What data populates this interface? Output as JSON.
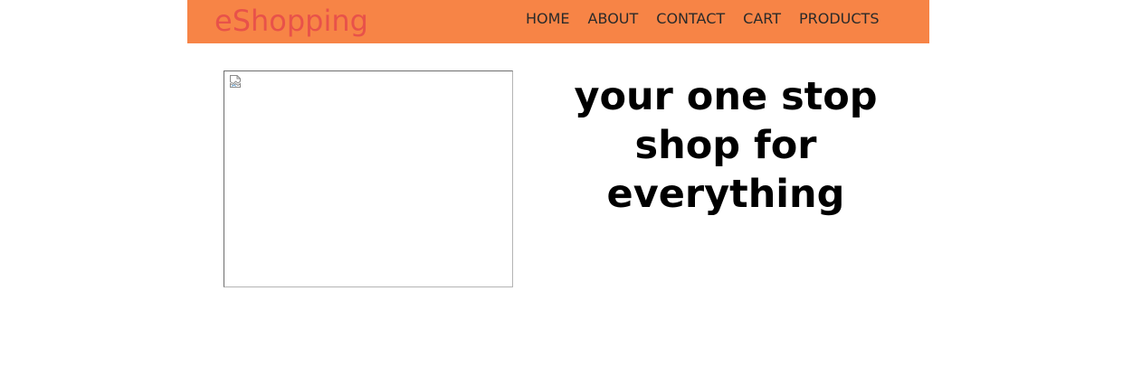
{
  "header": {
    "brand": "eShopping",
    "nav": [
      {
        "label": "HOME"
      },
      {
        "label": "ABOUT"
      },
      {
        "label": "CONTACT"
      },
      {
        "label": "CART"
      },
      {
        "label": "PRODUCTS"
      }
    ]
  },
  "hero": {
    "image_icon": "broken-image-icon",
    "tagline": "your one stop shop for everything"
  },
  "colors": {
    "navbar_bg": "#f78446",
    "brand": "#e8524a",
    "nav_text": "#2a2a2a",
    "tagline": "#000000"
  }
}
